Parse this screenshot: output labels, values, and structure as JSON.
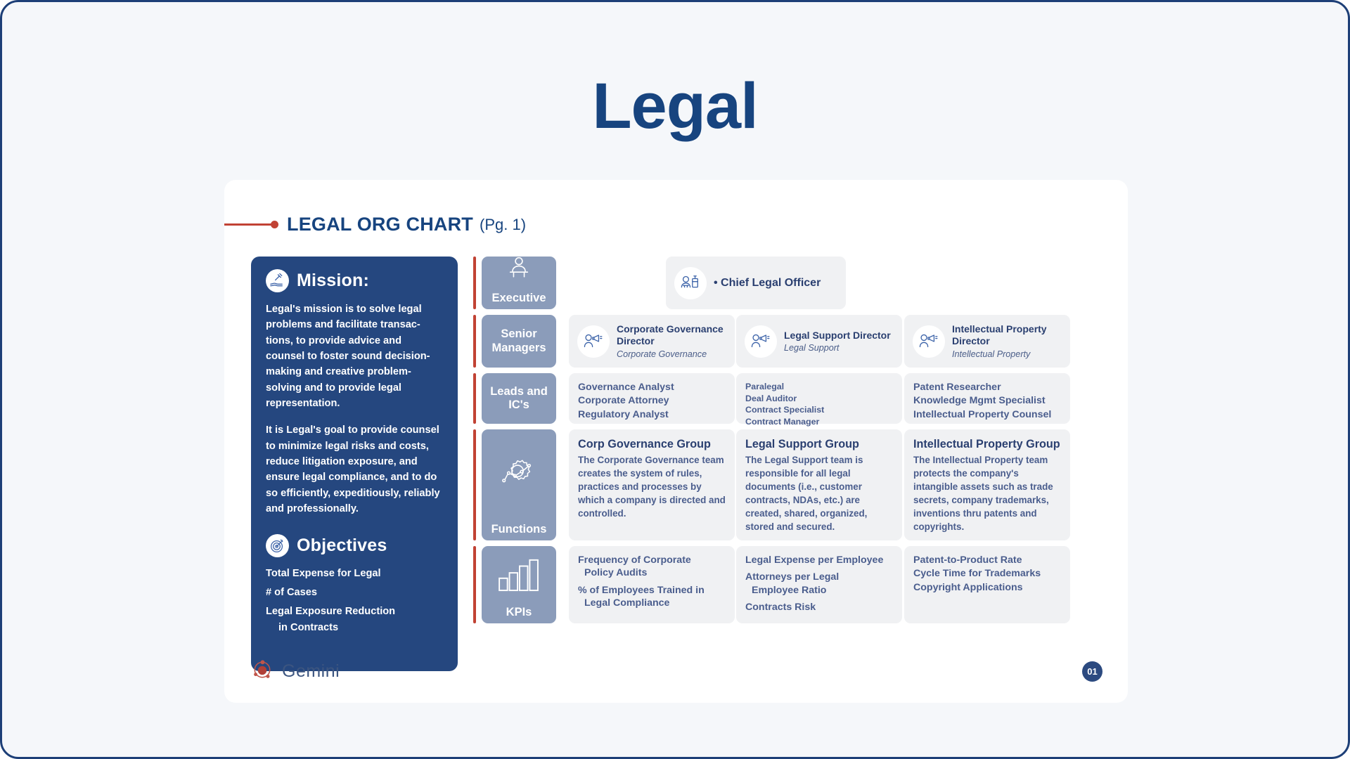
{
  "deck": {
    "title": "Legal",
    "section_title": "LEGAL ORG CHART",
    "section_subtitle": "(Pg. 1)",
    "page_number": "01",
    "brand_name": "Gemini",
    "colors": {
      "navy": "#25477f",
      "title_blue": "#17447f",
      "accent_red": "#c14234",
      "row_label": "#8b9cba",
      "cell_gray": "#f0f1f3",
      "page_bg": "#f5f7fa"
    }
  },
  "mission": {
    "heading": "Mission:",
    "icon": "hand-gavel-icon",
    "paragraphs": [
      "Legal's mission is to solve legal problems and facilitate transac-tions, to provide advice and counsel to foster sound decision-making and creative problem-solving and to provide legal representation.",
      "It is Legal's goal to provide counsel to minimize legal risks and costs, reduce litigation exposure, and ensure legal compliance, and to do so efficiently, expeditiously, reliably and professionally."
    ],
    "objectives_heading": "Objectives",
    "objectives_icon": "target-icon",
    "objectives": [
      {
        "text": "Total Expense for Legal",
        "cont": ""
      },
      {
        "text": "# of Cases",
        "cont": ""
      },
      {
        "text": "Legal Exposure Reduction",
        "cont": "in Contracts"
      }
    ]
  },
  "rows": [
    {
      "label": "Executive",
      "icon": "executive-podium-icon"
    },
    {
      "label": "Senior\nManagers",
      "icon": ""
    },
    {
      "label": "Leads and IC's",
      "icon": ""
    },
    {
      "label": "Functions",
      "icon": "gear-network-icon"
    },
    {
      "label": "KPIs",
      "icon": "bar-chart-icon"
    }
  ],
  "executive": {
    "icon": "officer-podium-icon",
    "name": "• Chief Legal Officer"
  },
  "directors": [
    {
      "icon": "person-megaphone-icon",
      "name": "Corporate Governance Director",
      "dept": "Corporate Governance"
    },
    {
      "icon": "person-megaphone-icon",
      "name": "Legal Support Director",
      "dept": "Legal Support"
    },
    {
      "icon": "person-megaphone-icon",
      "name": "Intellectual Property Director",
      "dept": "Intellectual Property"
    }
  ],
  "leads": [
    {
      "items": [
        "Governance Analyst",
        "Corporate Attorney",
        "Regulatory Analyst"
      ]
    },
    {
      "items": [
        "Paralegal",
        "Deal Auditor",
        "Contract Specialist",
        "Contract Manager"
      ]
    },
    {
      "items": [
        "Patent Researcher",
        "Knowledge Mgmt Specialist",
        "Intellectual Property Counsel"
      ]
    }
  ],
  "functions": [
    {
      "title": "Corp Governance Group",
      "body": "The Corporate Governance team creates the system of rules, practices and processes by which a company is directed and controlled."
    },
    {
      "title": "Legal Support Group",
      "body": "The Legal Support team is responsible for all legal documents (i.e., customer contracts, NDAs, etc.) are created, shared, organized, stored and secured."
    },
    {
      "title": "Intellectual Property Group",
      "body": "The Intellectual Property team protects the company's intangible assets such as trade secrets, company trademarks, inventions thru patents and copyrights."
    }
  ],
  "kpis": [
    {
      "items": [
        {
          "text": "Frequency of Corporate",
          "cont": "Policy Audits"
        },
        {
          "text": "% of Employees Trained in",
          "cont": "Legal Compliance"
        }
      ]
    },
    {
      "items": [
        {
          "text": "Legal Expense per Employee",
          "cont": ""
        },
        {
          "text": "Attorneys per Legal",
          "cont": "Employee Ratio"
        },
        {
          "text": "Contracts Risk",
          "cont": ""
        }
      ]
    },
    {
      "items": [
        {
          "text": "Patent-to-Product Rate",
          "cont": ""
        },
        {
          "text": "Cycle Time for Trademarks",
          "cont": ""
        },
        {
          "text": "Copyright Applications",
          "cont": ""
        }
      ]
    }
  ]
}
